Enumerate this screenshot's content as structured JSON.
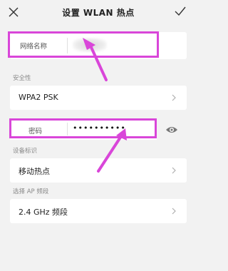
{
  "header": {
    "title": "设置 WLAN 热点",
    "close_icon": "close-icon",
    "confirm_icon": "checkmark-icon"
  },
  "ssid": {
    "label": "网络名称",
    "value_redacted": true
  },
  "security": {
    "section_label": "安全性",
    "value": "WPA2 PSK"
  },
  "password": {
    "label": "密码",
    "value": "••••••••••",
    "toggle_icon": "eye-icon"
  },
  "device": {
    "section_label": "设备标识",
    "value": "移动热点"
  },
  "band": {
    "section_label": "选择 AP 频段",
    "value": "2.4 GHz 频段"
  },
  "annotation": {
    "color": "#d946d9"
  }
}
